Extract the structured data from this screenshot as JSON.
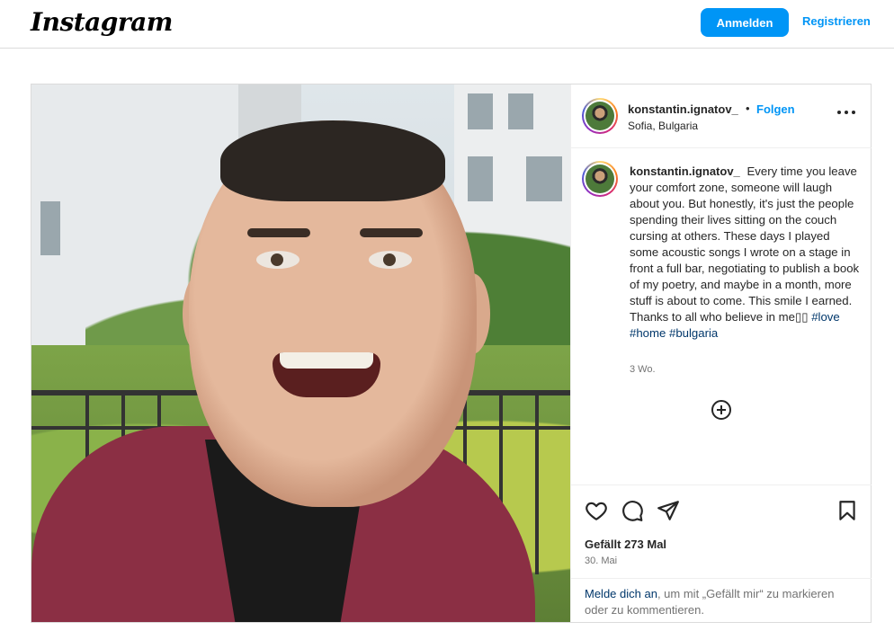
{
  "topbar": {
    "logo": "Instagram",
    "login_label": "Anmelden",
    "register_label": "Registrieren"
  },
  "post": {
    "author": {
      "username": "konstantin.ignatov_",
      "location": "Sofia, Bulgaria",
      "follow_label": "Folgen",
      "separator": "•"
    },
    "caption": {
      "username": "konstantin.ignatov_",
      "text": "Every time you leave your comfort zone, someone will laugh about you. But honestly, it's just the people spending their lives sitting on the couch cursing at others. These days I played some acoustic songs I wrote on a stage in front a full bar, negotiating to publish a book of my poetry, and maybe in a month, more stuff is about to come. This smile I earned. Thanks to all who believe in me",
      "hashtags": [
        "#love",
        "#home",
        "#bulgaria"
      ],
      "time_ago": "3 Wo."
    },
    "likes_text": "Gefällt 273 Mal",
    "date": "30. Mai",
    "login_prompt": {
      "link": "Melde dich an",
      "text": ", um mit „Gefällt mir“ zu markieren oder zu kommentieren."
    }
  },
  "icons": {
    "more": "more-options-icon",
    "add_comment": "add-circle-icon",
    "like": "heart-icon",
    "comment": "comment-icon",
    "share": "share-icon",
    "save": "bookmark-icon"
  },
  "colors": {
    "accent": "#0095f6",
    "hashtag": "#00376b",
    "border": "#dbdbdb",
    "muted": "#737373"
  }
}
